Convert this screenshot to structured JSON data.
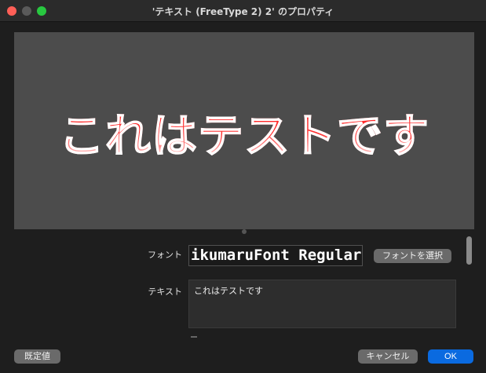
{
  "window": {
    "title": "'テキスト (FreeType 2) 2' のプロパティ"
  },
  "preview": {
    "text": "これはテストです"
  },
  "properties": {
    "font_label": "フォント",
    "font_value": "ikumaruFont Regular",
    "choose_font_label": "フォントを選択",
    "text_label": "テキスト",
    "text_value": "これはテストです"
  },
  "footer": {
    "defaults_label": "既定値",
    "cancel_label": "キャンセル",
    "ok_label": "OK"
  },
  "colors": {
    "accent": "#0a6ae0",
    "preview_text_top": "#ff1d1d",
    "preview_text_bottom": "#fff4f4",
    "close": "#ff5f57",
    "maximize": "#28c840"
  }
}
